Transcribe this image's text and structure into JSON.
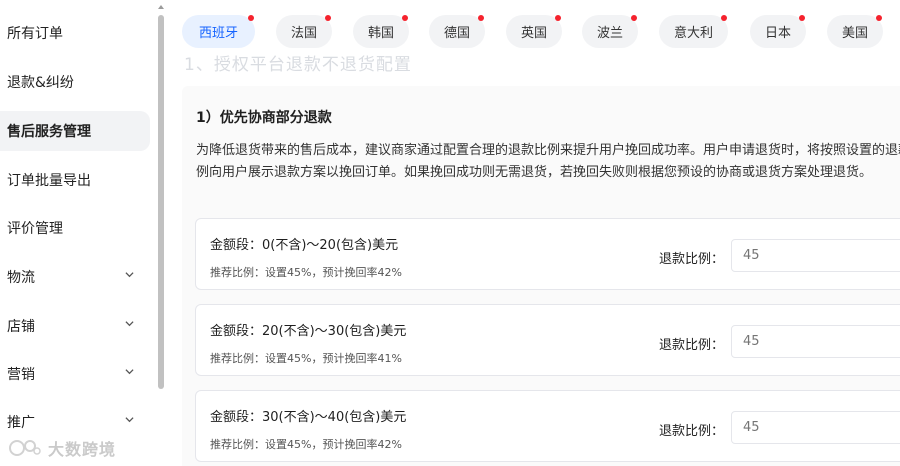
{
  "sidebar": {
    "items": [
      {
        "label": "所有订单",
        "expandable": false,
        "active": false
      },
      {
        "label": "退款&纠纷",
        "expandable": false,
        "active": false
      },
      {
        "label": "售后服务管理",
        "expandable": false,
        "active": true
      },
      {
        "label": "订单批量导出",
        "expandable": false,
        "active": false
      },
      {
        "label": "评价管理",
        "expandable": false,
        "active": false
      },
      {
        "label": "物流",
        "expandable": true,
        "active": false
      },
      {
        "label": "店铺",
        "expandable": true,
        "active": false
      },
      {
        "label": "营销",
        "expandable": true,
        "active": false
      },
      {
        "label": "推广",
        "expandable": true,
        "active": false
      }
    ]
  },
  "country_tabs": [
    {
      "label": "西班牙",
      "active": true,
      "has_dot": true
    },
    {
      "label": "法国",
      "active": false,
      "has_dot": true
    },
    {
      "label": "韩国",
      "active": false,
      "has_dot": true
    },
    {
      "label": "德国",
      "active": false,
      "has_dot": true
    },
    {
      "label": "英国",
      "active": false,
      "has_dot": true
    },
    {
      "label": "波兰",
      "active": false,
      "has_dot": true
    },
    {
      "label": "意大利",
      "active": false,
      "has_dot": true
    },
    {
      "label": "日本",
      "active": false,
      "has_dot": true
    },
    {
      "label": "美国",
      "active": false,
      "has_dot": true
    }
  ],
  "section_heading": "1、授权平台退款不退货配置",
  "panel": {
    "title": "1）优先协商部分退款",
    "description": "为降低退货带来的售后成本，建议商家通过配置合理的退款比例来提升用户挽回成功率。用户申请退货时，将按照设置的退款比例向用户展示退款方案以挽回订单。如果挽回成功则无需退货，若挽回失败则根据您预设的协商或退货方案处理退货。",
    "tiers": [
      {
        "range": "金额段：0(不含)～20(包含)美元",
        "recommendation": "推荐比例：设置45%，预计挽回率42%",
        "ratio_label": "退款比例：",
        "ratio_placeholder": "45"
      },
      {
        "range": "金额段：20(不含)～30(包含)美元",
        "recommendation": "推荐比例：设置45%，预计挽回率41%",
        "ratio_label": "退款比例：",
        "ratio_placeholder": "45"
      },
      {
        "range": "金额段：30(不含)～40(包含)美元",
        "recommendation": "推荐比例：设置45%，预计挽回率42%",
        "ratio_label": "退款比例：",
        "ratio_placeholder": "45"
      }
    ]
  },
  "watermark": "大数跨境",
  "colors": {
    "accent": "#1664ff",
    "badge": "#f5222d",
    "active_bg": "#f2f3f5"
  },
  "icons": {
    "expand": "chevron-down-icon",
    "notification": "red-dot-badge"
  }
}
